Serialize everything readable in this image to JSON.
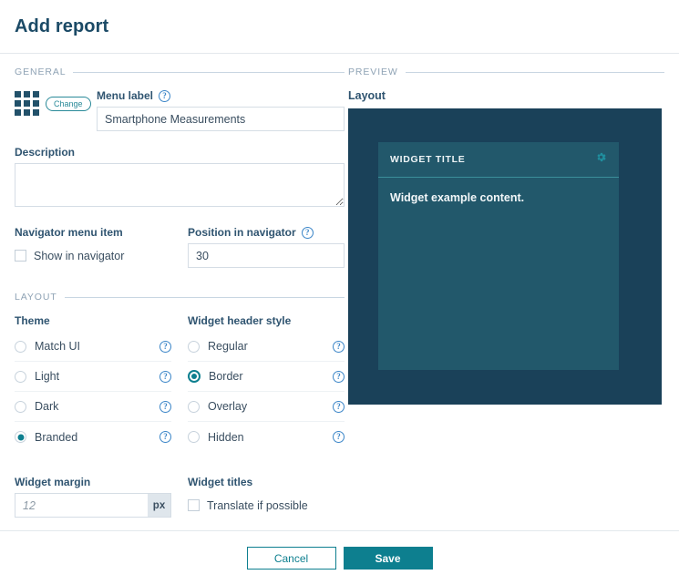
{
  "header": {
    "title": "Add report"
  },
  "sections": {
    "general": "GENERAL",
    "layout": "LAYOUT",
    "preview": "PREVIEW"
  },
  "general": {
    "change_button": "Change",
    "grid_icon": "grid-icon",
    "menu_label": {
      "label": "Menu label",
      "help": "?",
      "value": "Smartphone Measurements",
      "placeholder": ""
    },
    "description": {
      "label": "Description",
      "value": "",
      "placeholder": ""
    },
    "navigator_menu_item": {
      "label": "Navigator menu item",
      "checkbox_label": "Show in navigator",
      "checked": false
    },
    "position_in_navigator": {
      "label": "Position in navigator",
      "help": "?",
      "value": "30",
      "placeholder": ""
    }
  },
  "layout": {
    "theme": {
      "label": "Theme",
      "options": [
        {
          "label": "Match UI",
          "selected": false,
          "help": "?"
        },
        {
          "label": "Light",
          "selected": false,
          "help": "?"
        },
        {
          "label": "Dark",
          "selected": false,
          "help": "?"
        },
        {
          "label": "Branded",
          "selected": true,
          "help": "?"
        }
      ]
    },
    "widget_header_style": {
      "label": "Widget header style",
      "options": [
        {
          "label": "Regular",
          "selected": false,
          "help": "?"
        },
        {
          "label": "Border",
          "selected": true,
          "help": "?"
        },
        {
          "label": "Overlay",
          "selected": false,
          "help": "?"
        },
        {
          "label": "Hidden",
          "selected": false,
          "help": "?"
        }
      ]
    },
    "widget_margin": {
      "label": "Widget margin",
      "value": "",
      "placeholder": "12",
      "unit": "px"
    },
    "widget_titles": {
      "label": "Widget titles",
      "checkbox_label": "Translate if possible",
      "checked": false
    }
  },
  "preview": {
    "layout_label": "Layout",
    "widget": {
      "title": "WIDGET TITLE",
      "content": "Widget example content.",
      "gear_icon": "gear-icon"
    }
  },
  "footer": {
    "cancel": "Cancel",
    "save": "Save"
  },
  "colors": {
    "accent_teal": "#0d7f8f",
    "canvas_bg": "#1a4159",
    "widget_bg": "#22586b",
    "widget_border": "#3c8f9b",
    "heading": "#1b4a66",
    "help_blue": "#3c86c8"
  }
}
